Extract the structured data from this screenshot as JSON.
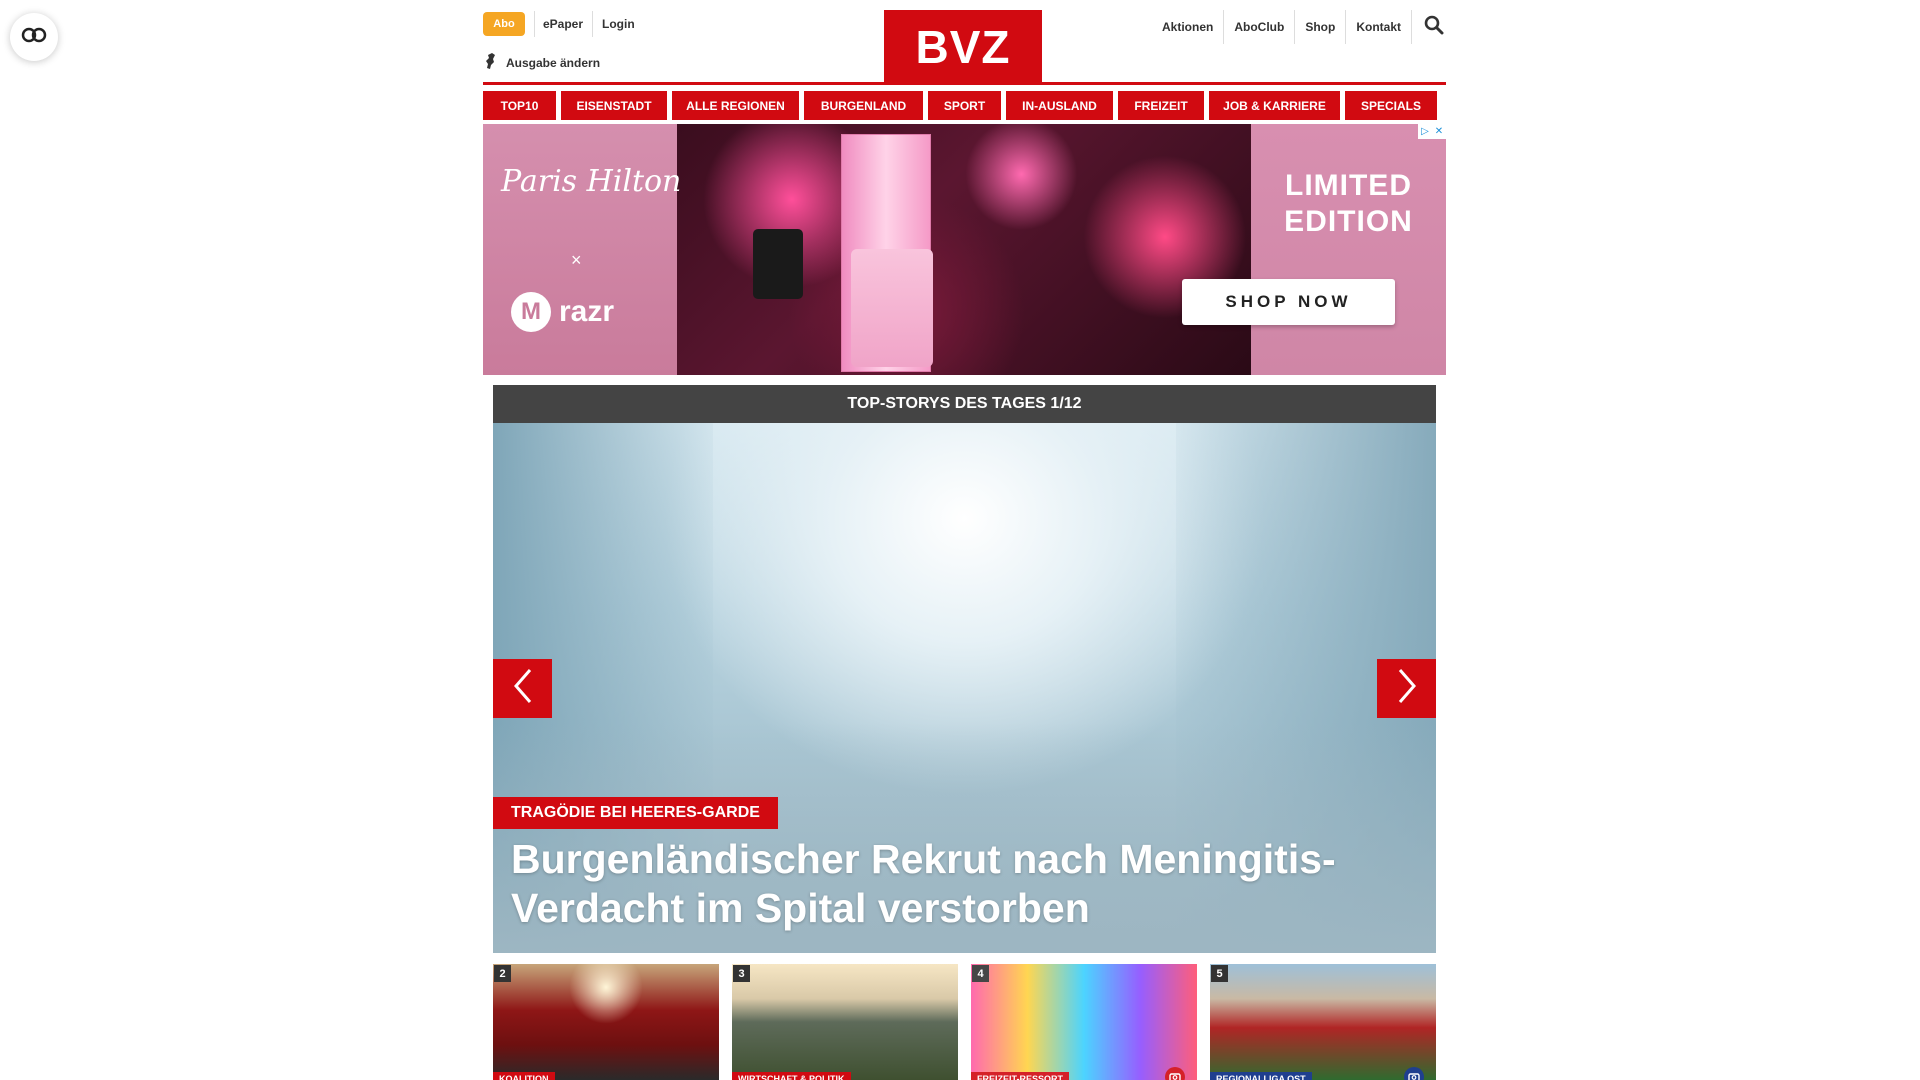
{
  "header": {
    "abo_label": "Abo",
    "epaper_label": "ePaper",
    "login_label": "Login",
    "edition_label": "Ausgabe ändern",
    "logo_text": "BVZ",
    "right_nav": [
      "Aktionen",
      "AboClub",
      "Shop",
      "Kontakt"
    ],
    "brand_color": "#d10a11",
    "abo_color": "#f5a623"
  },
  "categories": [
    "TOP10",
    "EISENSTADT",
    "ALLE REGIONEN",
    "BURGENLAND",
    "SPORT",
    "IN-AUSLAND",
    "FREIZEIT",
    "JOB & KARRIERE",
    "SPECIALS"
  ],
  "ad": {
    "brand1": "Paris Hilton",
    "connector": "×",
    "brand2": "razr",
    "brand2_mark": "M",
    "headline_line1": "LIMITED",
    "headline_line2": "EDITION",
    "cta": "SHOP NOW"
  },
  "top_stories": {
    "bar_title": "TOP-STORYS DES TAGES 1/12",
    "kicker": "TRAGÖDIE BEI HEERES-GARDE",
    "headline": "Burgenländischer Rekrut nach Meningitis-Verdacht im Spital verstorben"
  },
  "thumbnails": [
    {
      "num": "2",
      "tag": "KOALITION",
      "tag_color": "#d10a11"
    },
    {
      "num": "3",
      "tag": "WIRTSCHAFT & POLITIK",
      "tag_color": "#d10a11"
    },
    {
      "num": "4",
      "tag": "FREIZEIT-RESSORT",
      "tag_color": "#d10a11",
      "badge": "camera-icon"
    },
    {
      "num": "5",
      "tag": "REGIONALLIGA OST",
      "tag_color": "#1f3f8f",
      "badge": "camera-icon"
    }
  ]
}
